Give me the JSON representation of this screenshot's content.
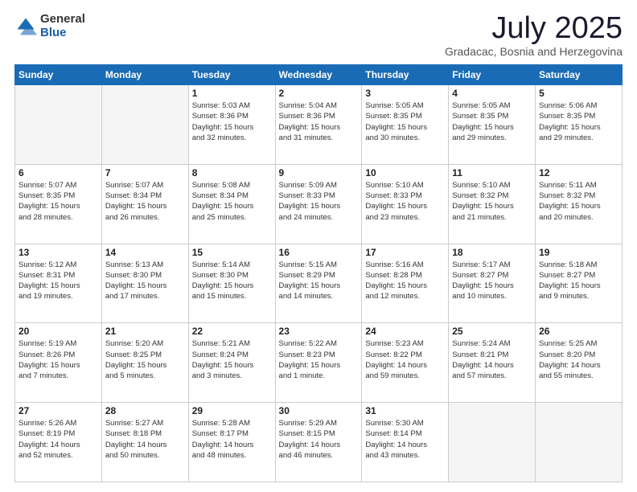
{
  "logo": {
    "general": "General",
    "blue": "Blue"
  },
  "header": {
    "month": "July 2025",
    "location": "Gradacac, Bosnia and Herzegovina"
  },
  "weekdays": [
    "Sunday",
    "Monday",
    "Tuesday",
    "Wednesday",
    "Thursday",
    "Friday",
    "Saturday"
  ],
  "weeks": [
    [
      {
        "day": "",
        "text": ""
      },
      {
        "day": "",
        "text": ""
      },
      {
        "day": "1",
        "text": "Sunrise: 5:03 AM\nSunset: 8:36 PM\nDaylight: 15 hours\nand 32 minutes."
      },
      {
        "day": "2",
        "text": "Sunrise: 5:04 AM\nSunset: 8:36 PM\nDaylight: 15 hours\nand 31 minutes."
      },
      {
        "day": "3",
        "text": "Sunrise: 5:05 AM\nSunset: 8:35 PM\nDaylight: 15 hours\nand 30 minutes."
      },
      {
        "day": "4",
        "text": "Sunrise: 5:05 AM\nSunset: 8:35 PM\nDaylight: 15 hours\nand 29 minutes."
      },
      {
        "day": "5",
        "text": "Sunrise: 5:06 AM\nSunset: 8:35 PM\nDaylight: 15 hours\nand 29 minutes."
      }
    ],
    [
      {
        "day": "6",
        "text": "Sunrise: 5:07 AM\nSunset: 8:35 PM\nDaylight: 15 hours\nand 28 minutes."
      },
      {
        "day": "7",
        "text": "Sunrise: 5:07 AM\nSunset: 8:34 PM\nDaylight: 15 hours\nand 26 minutes."
      },
      {
        "day": "8",
        "text": "Sunrise: 5:08 AM\nSunset: 8:34 PM\nDaylight: 15 hours\nand 25 minutes."
      },
      {
        "day": "9",
        "text": "Sunrise: 5:09 AM\nSunset: 8:33 PM\nDaylight: 15 hours\nand 24 minutes."
      },
      {
        "day": "10",
        "text": "Sunrise: 5:10 AM\nSunset: 8:33 PM\nDaylight: 15 hours\nand 23 minutes."
      },
      {
        "day": "11",
        "text": "Sunrise: 5:10 AM\nSunset: 8:32 PM\nDaylight: 15 hours\nand 21 minutes."
      },
      {
        "day": "12",
        "text": "Sunrise: 5:11 AM\nSunset: 8:32 PM\nDaylight: 15 hours\nand 20 minutes."
      }
    ],
    [
      {
        "day": "13",
        "text": "Sunrise: 5:12 AM\nSunset: 8:31 PM\nDaylight: 15 hours\nand 19 minutes."
      },
      {
        "day": "14",
        "text": "Sunrise: 5:13 AM\nSunset: 8:30 PM\nDaylight: 15 hours\nand 17 minutes."
      },
      {
        "day": "15",
        "text": "Sunrise: 5:14 AM\nSunset: 8:30 PM\nDaylight: 15 hours\nand 15 minutes."
      },
      {
        "day": "16",
        "text": "Sunrise: 5:15 AM\nSunset: 8:29 PM\nDaylight: 15 hours\nand 14 minutes."
      },
      {
        "day": "17",
        "text": "Sunrise: 5:16 AM\nSunset: 8:28 PM\nDaylight: 15 hours\nand 12 minutes."
      },
      {
        "day": "18",
        "text": "Sunrise: 5:17 AM\nSunset: 8:27 PM\nDaylight: 15 hours\nand 10 minutes."
      },
      {
        "day": "19",
        "text": "Sunrise: 5:18 AM\nSunset: 8:27 PM\nDaylight: 15 hours\nand 9 minutes."
      }
    ],
    [
      {
        "day": "20",
        "text": "Sunrise: 5:19 AM\nSunset: 8:26 PM\nDaylight: 15 hours\nand 7 minutes."
      },
      {
        "day": "21",
        "text": "Sunrise: 5:20 AM\nSunset: 8:25 PM\nDaylight: 15 hours\nand 5 minutes."
      },
      {
        "day": "22",
        "text": "Sunrise: 5:21 AM\nSunset: 8:24 PM\nDaylight: 15 hours\nand 3 minutes."
      },
      {
        "day": "23",
        "text": "Sunrise: 5:22 AM\nSunset: 8:23 PM\nDaylight: 15 hours\nand 1 minute."
      },
      {
        "day": "24",
        "text": "Sunrise: 5:23 AM\nSunset: 8:22 PM\nDaylight: 14 hours\nand 59 minutes."
      },
      {
        "day": "25",
        "text": "Sunrise: 5:24 AM\nSunset: 8:21 PM\nDaylight: 14 hours\nand 57 minutes."
      },
      {
        "day": "26",
        "text": "Sunrise: 5:25 AM\nSunset: 8:20 PM\nDaylight: 14 hours\nand 55 minutes."
      }
    ],
    [
      {
        "day": "27",
        "text": "Sunrise: 5:26 AM\nSunset: 8:19 PM\nDaylight: 14 hours\nand 52 minutes."
      },
      {
        "day": "28",
        "text": "Sunrise: 5:27 AM\nSunset: 8:18 PM\nDaylight: 14 hours\nand 50 minutes."
      },
      {
        "day": "29",
        "text": "Sunrise: 5:28 AM\nSunset: 8:17 PM\nDaylight: 14 hours\nand 48 minutes."
      },
      {
        "day": "30",
        "text": "Sunrise: 5:29 AM\nSunset: 8:15 PM\nDaylight: 14 hours\nand 46 minutes."
      },
      {
        "day": "31",
        "text": "Sunrise: 5:30 AM\nSunset: 8:14 PM\nDaylight: 14 hours\nand 43 minutes."
      },
      {
        "day": "",
        "text": ""
      },
      {
        "day": "",
        "text": ""
      }
    ]
  ]
}
